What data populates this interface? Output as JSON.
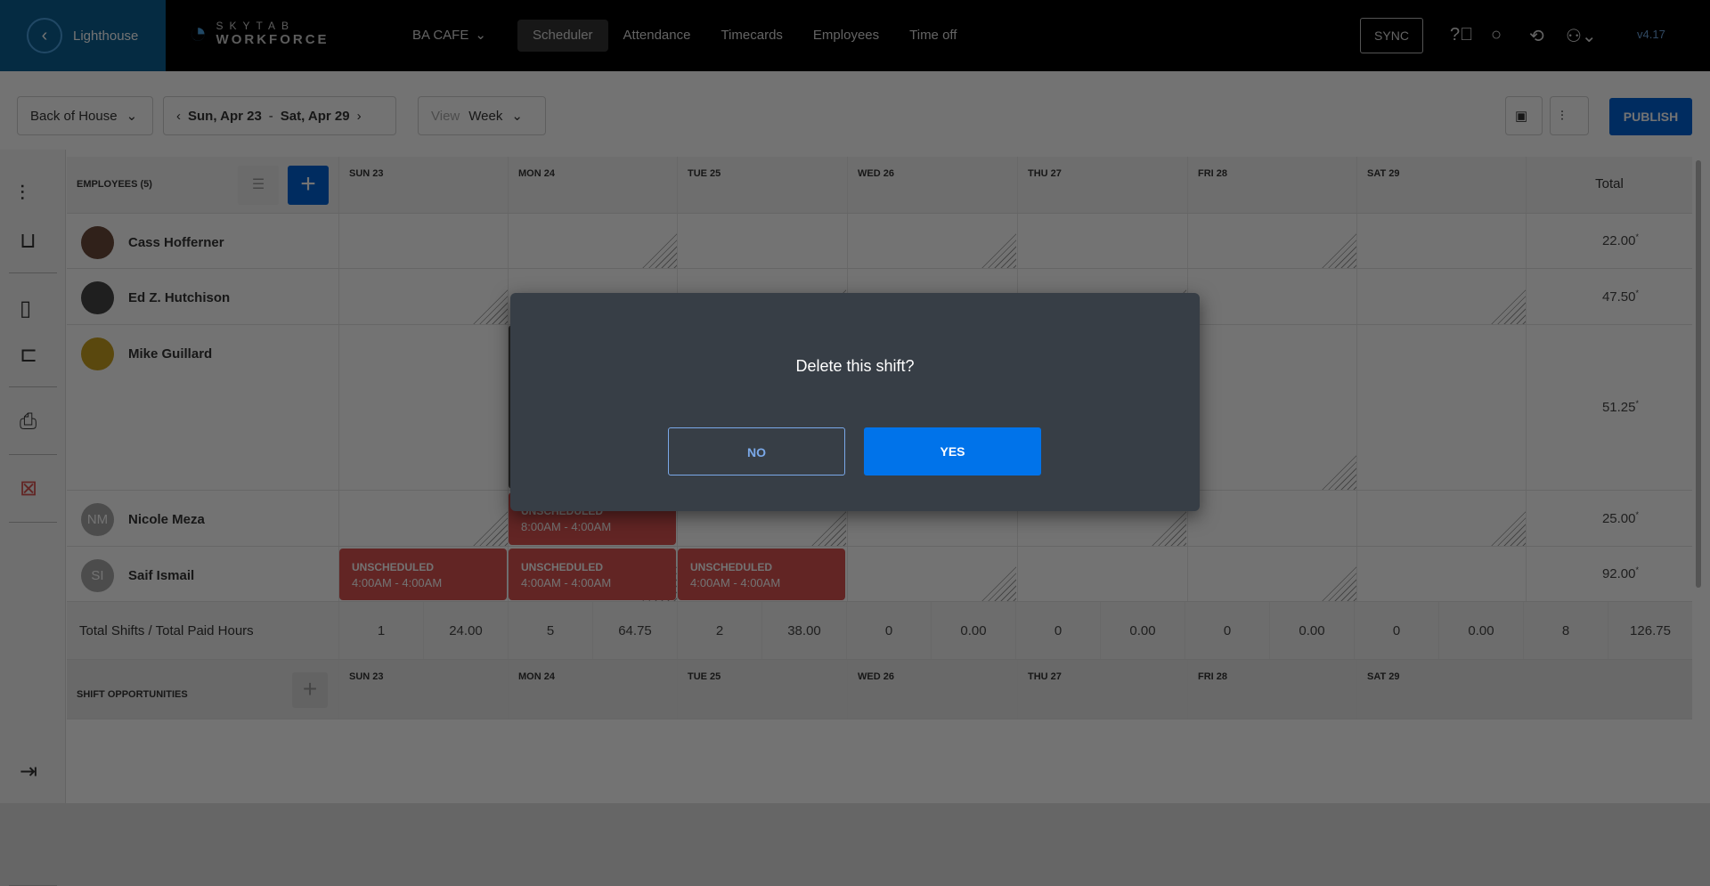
{
  "header": {
    "back_label": "Lighthouse",
    "logo_top": "SKYTAB",
    "logo_bottom": "WORKFORCE",
    "location": "BA CAFE",
    "nav": [
      "Scheduler",
      "Attendance",
      "Timecards",
      "Employees",
      "Time off"
    ],
    "active_nav": "Scheduler",
    "sync_label": "SYNC",
    "version": "v4.17"
  },
  "toolbar": {
    "department": "Back of House",
    "date_range_start": "Sun, Apr 23",
    "date_range_sep": " - ",
    "date_range_end": "Sat, Apr 29",
    "view_label": "View",
    "view_value": "Week",
    "publish_label": "PUBLISH"
  },
  "grid": {
    "employees_header": "EMPLOYEES (5)",
    "days": [
      "SUN 23",
      "MON 24",
      "TUE 25",
      "WED 26",
      "THU 27",
      "FRI 28",
      "SAT 29"
    ],
    "total_header": "Total",
    "employees": [
      {
        "name": "Cass Hofferner",
        "initials": "",
        "total": "22.00",
        "asterisk": "*"
      },
      {
        "name": "Ed Z. Hutchison",
        "initials": "",
        "total": "47.50",
        "asterisk": "*"
      },
      {
        "name": "Mike Guillard",
        "initials": "",
        "total": "51.25",
        "asterisk": "*"
      },
      {
        "name": "Nicole Meza",
        "initials": "NM",
        "total": "25.00",
        "asterisk": "*"
      },
      {
        "name": "Saif Ismail",
        "initials": "SI",
        "total": "92.00",
        "asterisk": "*"
      }
    ],
    "shifts": {
      "nicole_mon": {
        "label": "UNSCHEDULED",
        "time": "8:00AM - 4:00AM"
      },
      "saif_sun": {
        "label": "UNSCHEDULED",
        "time": "4:00AM - 4:00AM"
      },
      "saif_mon": {
        "label": "UNSCHEDULED",
        "time": "4:00AM - 4:00AM"
      },
      "saif_tue": {
        "label": "UNSCHEDULED",
        "time": "4:00AM - 4:00AM"
      }
    },
    "totals_label": "Total Shifts / Total Paid Hours",
    "totals": [
      "1",
      "24.00",
      "5",
      "64.75",
      "2",
      "38.00",
      "0",
      "0.00",
      "0",
      "0.00",
      "0",
      "0.00",
      "0",
      "0.00",
      "8",
      "126.75"
    ],
    "shift_opportunities_label": "SHIFT OPPORTUNITIES"
  },
  "dialog": {
    "question": "Delete this shift?",
    "no_label": "NO",
    "yes_label": "YES"
  },
  "colors": {
    "accent": "#0073ea",
    "unscheduled": "#d9534f",
    "dialog_bg": "#373e46"
  }
}
